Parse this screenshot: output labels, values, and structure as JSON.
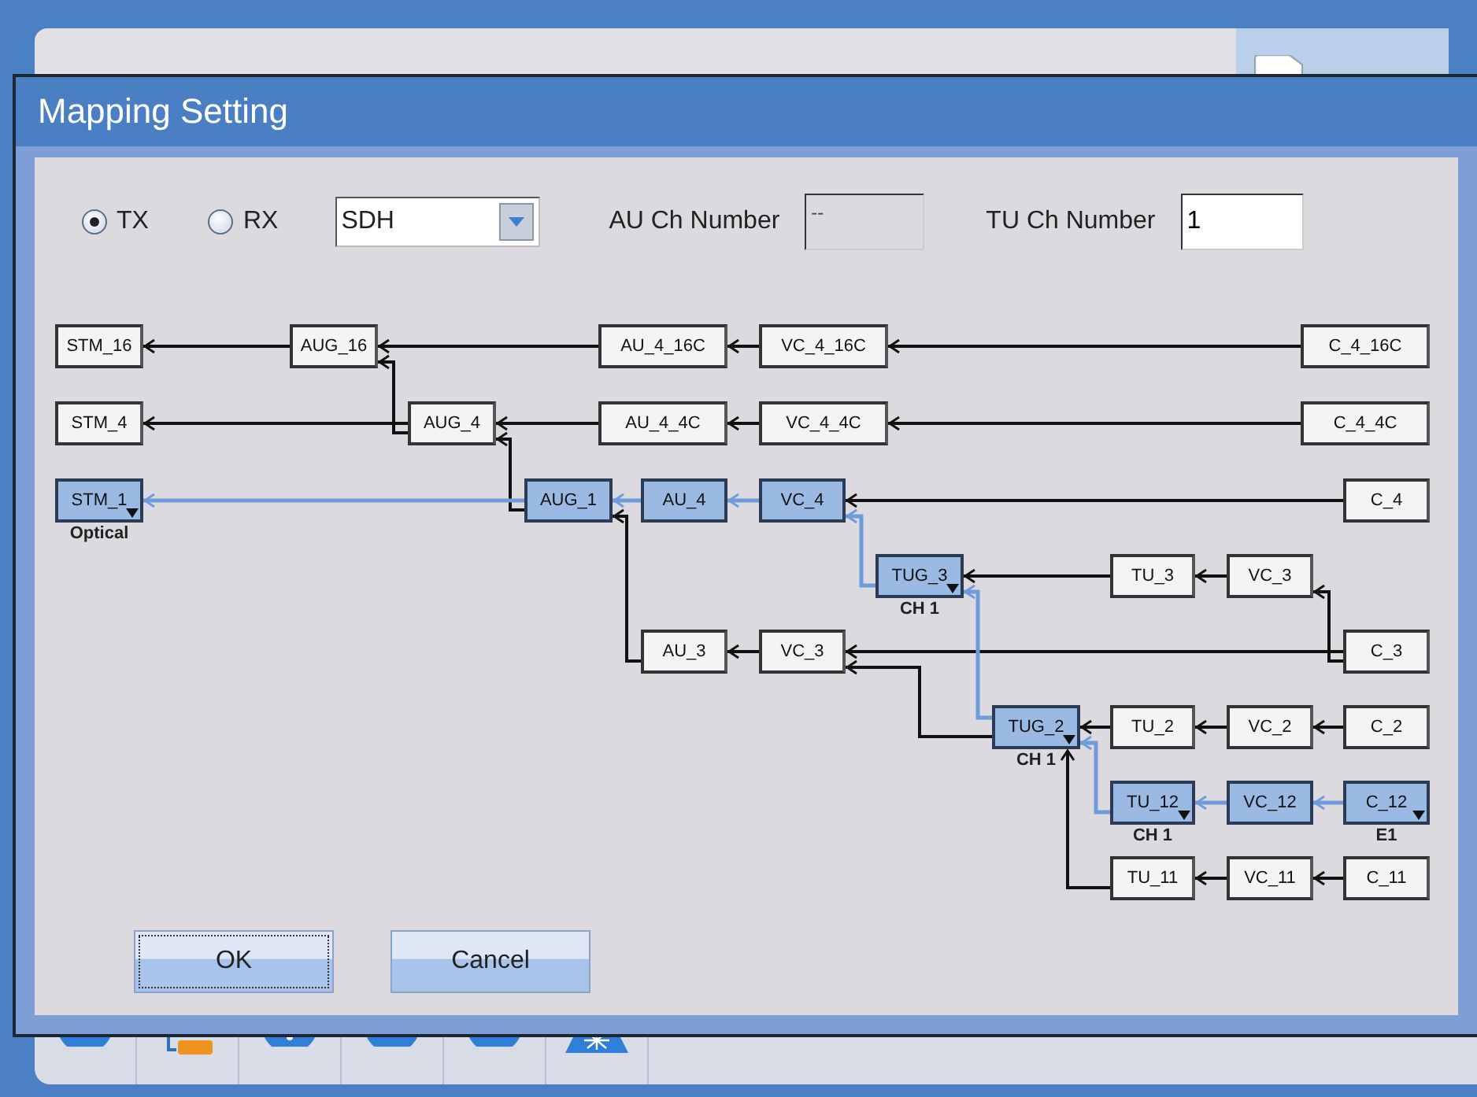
{
  "window": {
    "title": "Mapping Setting"
  },
  "direction": [
    {
      "label": "TX",
      "selected": true
    },
    {
      "label": "RX",
      "selected": false
    }
  ],
  "mode_select": {
    "value": "SDH"
  },
  "au_ch_number": {
    "label": "AU Ch Number",
    "value": "--",
    "disabled": true
  },
  "tu_ch_number": {
    "label": "TU Ch Number",
    "value": "1",
    "disabled": false
  },
  "diagram": {
    "nodes": [
      {
        "label": "STM_16",
        "selected": false,
        "dropdown": false
      },
      {
        "label": "AUG_16",
        "selected": false,
        "dropdown": false
      },
      {
        "label": "AU_4_16C",
        "selected": false,
        "dropdown": false
      },
      {
        "label": "VC_4_16C",
        "selected": false,
        "dropdown": false
      },
      {
        "label": "C_4_16C",
        "selected": false,
        "dropdown": false
      },
      {
        "label": "STM_4",
        "selected": false,
        "dropdown": false
      },
      {
        "label": "AUG_4",
        "selected": false,
        "dropdown": false
      },
      {
        "label": "AU_4_4C",
        "selected": false,
        "dropdown": false
      },
      {
        "label": "VC_4_4C",
        "selected": false,
        "dropdown": false
      },
      {
        "label": "C_4_4C",
        "selected": false,
        "dropdown": false
      },
      {
        "label": "STM_1",
        "selected": true,
        "dropdown": true,
        "caption": "Optical"
      },
      {
        "label": "AUG_1",
        "selected": true,
        "dropdown": false
      },
      {
        "label": "AU_4",
        "selected": true,
        "dropdown": false
      },
      {
        "label": "VC_4",
        "selected": true,
        "dropdown": false
      },
      {
        "label": "C_4",
        "selected": false,
        "dropdown": false
      },
      {
        "label": "TUG_3",
        "selected": true,
        "dropdown": true,
        "caption": "CH 1"
      },
      {
        "label": "TU_3",
        "selected": false,
        "dropdown": false
      },
      {
        "label": "VC_3",
        "selected": false,
        "dropdown": false
      },
      {
        "label": "AU_3",
        "selected": false,
        "dropdown": false
      },
      {
        "label": "VC_3",
        "selected": false,
        "dropdown": false
      },
      {
        "label": "C_3",
        "selected": false,
        "dropdown": false
      },
      {
        "label": "TUG_2",
        "selected": true,
        "dropdown": true,
        "caption": "CH 1"
      },
      {
        "label": "TU_2",
        "selected": false,
        "dropdown": false
      },
      {
        "label": "VC_2",
        "selected": false,
        "dropdown": false
      },
      {
        "label": "C_2",
        "selected": false,
        "dropdown": false
      },
      {
        "label": "TU_12",
        "selected": true,
        "dropdown": true,
        "caption": "CH 1"
      },
      {
        "label": "VC_12",
        "selected": true,
        "dropdown": false
      },
      {
        "label": "C_12",
        "selected": true,
        "dropdown": true,
        "caption": "E1"
      },
      {
        "label": "TU_11",
        "selected": false,
        "dropdown": false
      },
      {
        "label": "VC_11",
        "selected": false,
        "dropdown": false
      },
      {
        "label": "C_11",
        "selected": false,
        "dropdown": false
      }
    ],
    "links": [
      {
        "active": false
      },
      {
        "active": false
      },
      {
        "active": false
      },
      {
        "active": false
      },
      {
        "active": false
      },
      {
        "active": false
      },
      {
        "active": false
      },
      {
        "active": false
      },
      {
        "active": false
      },
      {
        "active": false
      },
      {
        "active": true
      },
      {
        "active": true
      },
      {
        "active": true
      },
      {
        "active": false
      },
      {
        "active": true
      },
      {
        "active": false
      },
      {
        "active": false
      },
      {
        "active": false
      },
      {
        "active": false
      },
      {
        "active": false
      },
      {
        "active": false
      },
      {
        "active": false
      },
      {
        "active": true
      },
      {
        "active": false
      },
      {
        "active": false
      },
      {
        "active": false
      },
      {
        "active": true
      },
      {
        "active": true
      },
      {
        "active": true
      },
      {
        "active": false
      },
      {
        "active": false
      },
      {
        "active": false
      }
    ]
  },
  "buttons": [
    {
      "label": "OK",
      "focused": true
    },
    {
      "label": "Cancel",
      "focused": false
    }
  ]
}
